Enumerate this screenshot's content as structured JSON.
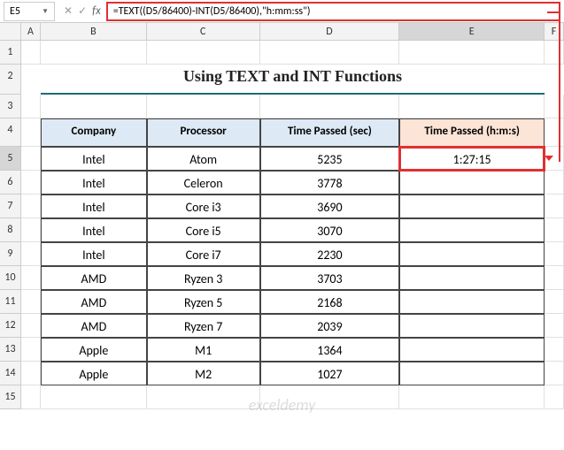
{
  "nameBox": "E5",
  "formula": "=TEXT((D5/86400)-INT(D5/86400),\"h:mm:ss\")",
  "columns": [
    "A",
    "B",
    "C",
    "D",
    "E",
    "F"
  ],
  "title": "Using TEXT and INT Functions",
  "headers": {
    "company": "Company",
    "processor": "Processor",
    "timeSec": "Time Passed (sec)",
    "timeHms": "Time Passed (h:m:s)"
  },
  "selectedResult": "1:27:15",
  "rows": [
    {
      "n": "5",
      "company": "Intel",
      "processor": "Atom",
      "sec": "5235",
      "hms": "1:27:15"
    },
    {
      "n": "6",
      "company": "Intel",
      "processor": "Celeron",
      "sec": "3778",
      "hms": ""
    },
    {
      "n": "7",
      "company": "Intel",
      "processor": "Core i3",
      "sec": "3690",
      "hms": ""
    },
    {
      "n": "8",
      "company": "Intel",
      "processor": "Core i5",
      "sec": "3070",
      "hms": ""
    },
    {
      "n": "9",
      "company": "Intel",
      "processor": "Core i7",
      "sec": "2230",
      "hms": ""
    },
    {
      "n": "10",
      "company": "AMD",
      "processor": "Ryzen 3",
      "sec": "3703",
      "hms": ""
    },
    {
      "n": "11",
      "company": "AMD",
      "processor": "Ryzen 5",
      "sec": "2168",
      "hms": ""
    },
    {
      "n": "12",
      "company": "AMD",
      "processor": "Ryzen 7",
      "sec": "2039",
      "hms": ""
    },
    {
      "n": "13",
      "company": "Apple",
      "processor": "M1",
      "sec": "1364",
      "hms": ""
    },
    {
      "n": "14",
      "company": "Apple",
      "processor": "M2",
      "sec": "1027",
      "hms": ""
    }
  ],
  "emptyRows": [
    "1",
    "3",
    "15"
  ],
  "watermark": "exceldemy"
}
